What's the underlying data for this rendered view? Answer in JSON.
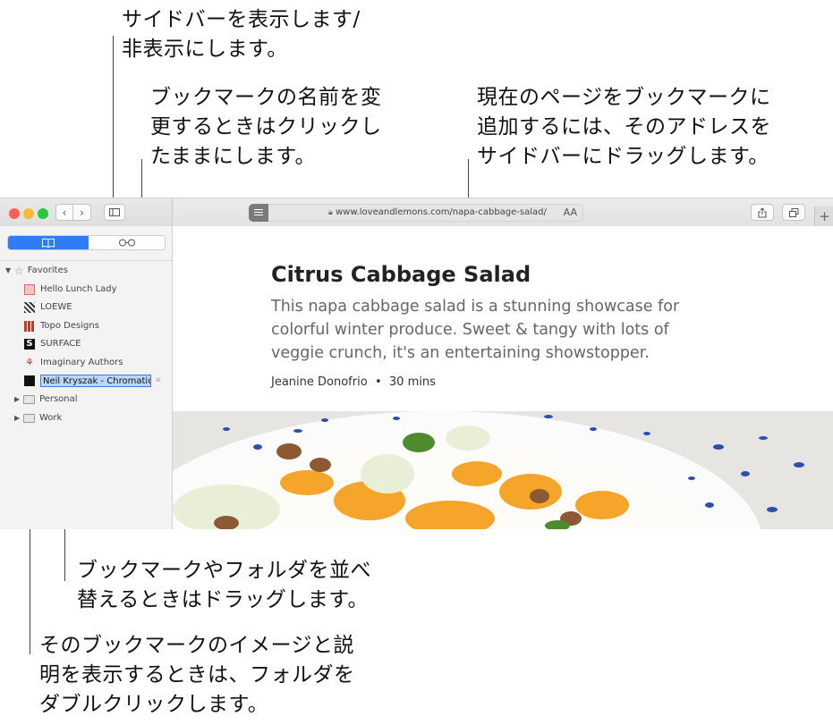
{
  "callouts": {
    "sidebar_toggle": "サイドバーを表示します/\n非表示にします。",
    "rename": "ブックマークの名前を変\n更するときはクリックし\nたままにします。",
    "add_page": "現在のページをブックマークに\n追加するには、そのアドレスを\nサイドバーにドラッグします。",
    "rearrange": "ブックマークやフォルダを並べ\n替えるときはドラッグします。",
    "folder_view": "そのブックマークのイメージと説\n明を表示するときは、フォルダを\nダブルクリックします。"
  },
  "toolbar": {
    "url": "www.loveandlemons.com/napa-cabbage-salad/",
    "text_size": "AA",
    "new_tab": "+"
  },
  "sidebar": {
    "favorites_label": "Favorites",
    "bookmarks": [
      {
        "label": "Hello Lunch Lady",
        "color": "#e06a6a"
      },
      {
        "label": "LOEWE",
        "color": "#444444"
      },
      {
        "label": "Topo Designs",
        "color": "#c0392b"
      },
      {
        "label": "SURFACE",
        "color": "#111111"
      },
      {
        "label": "Imaginary Authors",
        "color": "#c0392b"
      }
    ],
    "editing_label": "Neil Kryszak - Chromatic E",
    "folders": [
      "Personal",
      "Work"
    ]
  },
  "article": {
    "title": "Citrus Cabbage Salad",
    "description": "This napa cabbage salad is a stunning showcase for colorful winter produce. Sweet & tangy with lots of veggie crunch, it's an entertaining showstopper.",
    "author": "Jeanine Donofrio",
    "time": "30 mins"
  },
  "colors": {
    "accent": "#2f7df6",
    "close": "#fc5f57",
    "minimize": "#fdbc2e",
    "zoom": "#28c840"
  }
}
